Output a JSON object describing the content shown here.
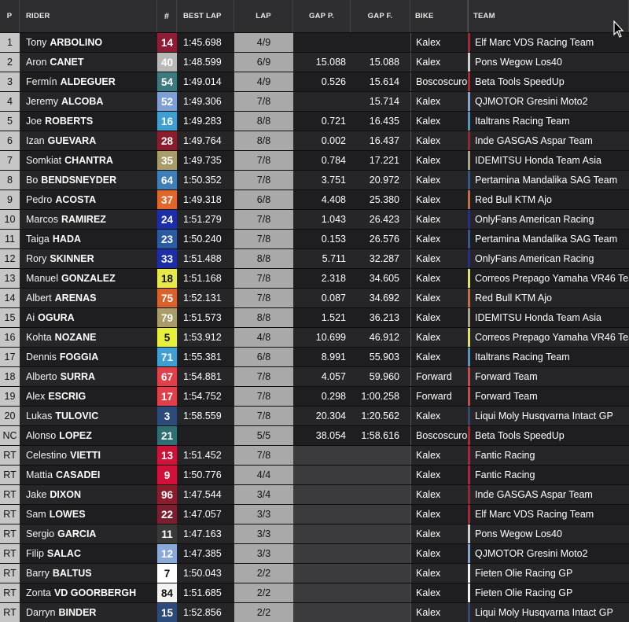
{
  "header": {
    "pos": "P",
    "rider": "RIDER",
    "number": "#",
    "best_lap": "BEST LAP",
    "lap": "LAP",
    "gap_prev": "GAP P.",
    "gap_first": "GAP F.",
    "bike": "BIKE",
    "team": "TEAM"
  },
  "rows": [
    {
      "pos": "1",
      "first": "Tony",
      "last": "ARBOLINO",
      "num": "14",
      "num_color": "#8e1c34",
      "text_dark": false,
      "best": "1:45.698",
      "lap": "4/9",
      "gap_p": "",
      "gap_f": "",
      "bike": "Kalex",
      "team": "Elf Marc VDS Racing Team",
      "team_color": "#c4182b"
    },
    {
      "pos": "2",
      "first": "Aron",
      "last": "CANET",
      "num": "40",
      "num_color": "#b8b8b8",
      "text_dark": false,
      "best": "1:48.599",
      "lap": "6/9",
      "gap_p": "15.088",
      "gap_f": "15.088",
      "bike": "Kalex",
      "team": "Pons Wegow Los40",
      "team_color": "#d0d0d0"
    },
    {
      "pos": "3",
      "first": "Fermín",
      "last": "ALDEGUER",
      "num": "54",
      "num_color": "#3d7a7f",
      "text_dark": false,
      "best": "1:49.014",
      "lap": "4/9",
      "gap_p": "0.526",
      "gap_f": "15.614",
      "bike": "Boscoscuro",
      "team": "Beta Tools SpeedUp",
      "team_color": "#c81d25"
    },
    {
      "pos": "4",
      "first": "Jeremy",
      "last": "ALCOBA",
      "num": "52",
      "num_color": "#7d9fd6",
      "text_dark": false,
      "best": "1:49.306",
      "lap": "7/8",
      "gap_p": "",
      "gap_f": "15.714",
      "bike": "Kalex",
      "team": "QJMOTOR Gresini Moto2",
      "team_color": "#7da7dd"
    },
    {
      "pos": "5",
      "first": "Joe",
      "last": "ROBERTS",
      "num": "16",
      "num_color": "#3e9fd0",
      "text_dark": false,
      "best": "1:49.283",
      "lap": "8/8",
      "gap_p": "0.721",
      "gap_f": "16.435",
      "bike": "Kalex",
      "team": "Italtrans Racing Team",
      "team_color": "#3e9fd0"
    },
    {
      "pos": "6",
      "first": "Izan",
      "last": "GUEVARA",
      "num": "28",
      "num_color": "#8c1c2c",
      "text_dark": false,
      "best": "1:49.764",
      "lap": "8/8",
      "gap_p": "0.002",
      "gap_f": "16.437",
      "bike": "Kalex",
      "team": "Inde GASGAS Aspar Team",
      "team_color": "#b01a2a"
    },
    {
      "pos": "7",
      "first": "Somkiat",
      "last": "CHANTRA",
      "num": "35",
      "num_color": "#a89c6a",
      "text_dark": false,
      "best": "1:49.735",
      "lap": "7/8",
      "gap_p": "0.784",
      "gap_f": "17.221",
      "bike": "Kalex",
      "team": "IDEMITSU Honda Team Asia",
      "team_color": "#b0a578"
    },
    {
      "pos": "8",
      "first": "Bo",
      "last": "BENDSNEYDER",
      "num": "64",
      "num_color": "#3e7fb8",
      "text_dark": false,
      "best": "1:50.352",
      "lap": "7/8",
      "gap_p": "3.751",
      "gap_f": "20.972",
      "bike": "Kalex",
      "team": "Pertamina Mandalika SAG Team",
      "team_color": "#2c5aa0"
    },
    {
      "pos": "9",
      "first": "Pedro",
      "last": "ACOSTA",
      "num": "37",
      "num_color": "#e0662a",
      "text_dark": false,
      "best": "1:49.318",
      "lap": "6/8",
      "gap_p": "4.408",
      "gap_f": "25.380",
      "bike": "Kalex",
      "team": "Red Bull KTM Ajo",
      "team_color": "#e0662a"
    },
    {
      "pos": "10",
      "first": "Marcos",
      "last": "RAMIREZ",
      "num": "24",
      "num_color": "#1b2da8",
      "text_dark": false,
      "best": "1:51.279",
      "lap": "7/8",
      "gap_p": "1.043",
      "gap_f": "26.423",
      "bike": "Kalex",
      "team": "OnlyFans American Racing",
      "team_color": "#1b2da8"
    },
    {
      "pos": "11",
      "first": "Taiga",
      "last": "HADA",
      "num": "23",
      "num_color": "#2c5aa0",
      "text_dark": false,
      "best": "1:50.240",
      "lap": "7/8",
      "gap_p": "0.153",
      "gap_f": "26.576",
      "bike": "Kalex",
      "team": "Pertamina Mandalika SAG Team",
      "team_color": "#2c5aa0"
    },
    {
      "pos": "12",
      "first": "Rory",
      "last": "SKINNER",
      "num": "33",
      "num_color": "#1b2da8",
      "text_dark": false,
      "best": "1:51.488",
      "lap": "8/8",
      "gap_p": "5.711",
      "gap_f": "32.287",
      "bike": "Kalex",
      "team": "OnlyFans American Racing",
      "team_color": "#1b2da8"
    },
    {
      "pos": "13",
      "first": "Manuel",
      "last": "GONZALEZ",
      "num": "18",
      "num_color": "#e6e84a",
      "text_dark": true,
      "best": "1:51.168",
      "lap": "7/8",
      "gap_p": "2.318",
      "gap_f": "34.605",
      "bike": "Kalex",
      "team": "Correos Prepago Yamaha VR46 Tean",
      "team_color": "#e6e84a"
    },
    {
      "pos": "14",
      "first": "Albert",
      "last": "ARENAS",
      "num": "75",
      "num_color": "#d9622a",
      "text_dark": false,
      "best": "1:52.131",
      "lap": "7/8",
      "gap_p": "0.087",
      "gap_f": "34.692",
      "bike": "Kalex",
      "team": "Red Bull KTM Ajo",
      "team_color": "#e0662a"
    },
    {
      "pos": "15",
      "first": "Ai",
      "last": "OGURA",
      "num": "79",
      "num_color": "#a89c6a",
      "text_dark": false,
      "best": "1:51.573",
      "lap": "8/8",
      "gap_p": "1.521",
      "gap_f": "36.213",
      "bike": "Kalex",
      "team": "IDEMITSU Honda Team Asia",
      "team_color": "#b0a578"
    },
    {
      "pos": "16",
      "first": "Kohta",
      "last": "NOZANE",
      "num": "5",
      "num_color": "#e6f03c",
      "text_dark": true,
      "best": "1:53.912",
      "lap": "4/8",
      "gap_p": "10.699",
      "gap_f": "46.912",
      "bike": "Kalex",
      "team": "Correos Prepago Yamaha VR46 Tean",
      "team_color": "#e6e84a"
    },
    {
      "pos": "17",
      "first": "Dennis",
      "last": "FOGGIA",
      "num": "71",
      "num_color": "#3e9fd0",
      "text_dark": false,
      "best": "1:55.381",
      "lap": "6/8",
      "gap_p": "8.991",
      "gap_f": "55.903",
      "bike": "Kalex",
      "team": "Italtrans Racing Team",
      "team_color": "#3e9fd0"
    },
    {
      "pos": "18",
      "first": "Alberto",
      "last": "SURRA",
      "num": "67",
      "num_color": "#e0404a",
      "text_dark": false,
      "best": "1:54.881",
      "lap": "7/8",
      "gap_p": "4.057",
      "gap_f": "59.960",
      "bike": "Forward",
      "team": "Forward Team",
      "team_color": "#e04040"
    },
    {
      "pos": "19",
      "first": "Alex",
      "last": "ESCRIG",
      "num": "17",
      "num_color": "#e0404a",
      "text_dark": false,
      "best": "1:54.752",
      "lap": "7/8",
      "gap_p": "0.298",
      "gap_f": "1:00.258",
      "bike": "Forward",
      "team": "Forward Team",
      "team_color": "#e04040"
    },
    {
      "pos": "20",
      "first": "Lukas",
      "last": "TULOVIC",
      "num": "3",
      "num_color": "#2c4a7a",
      "text_dark": false,
      "best": "1:58.559",
      "lap": "7/8",
      "gap_p": "20.304",
      "gap_f": "1:20.562",
      "bike": "Kalex",
      "team": "Liqui Moly Husqvarna Intact GP",
      "team_color": "#2c4a7a"
    },
    {
      "pos": "NC",
      "first": "Alonso",
      "last": "LOPEZ",
      "num": "21",
      "num_color": "#2e6f73",
      "text_dark": false,
      "best": "",
      "lap": "5/5",
      "gap_p": "38.054",
      "gap_f": "1:58.616",
      "bike": "Boscoscuro",
      "team": "Beta Tools SpeedUp",
      "team_color": "#c81d25"
    },
    {
      "pos": "RT",
      "first": "Celestino",
      "last": "VIETTI",
      "num": "13",
      "num_color": "#d0123a",
      "text_dark": false,
      "best": "1:51.452",
      "lap": "7/8",
      "gap_p": "",
      "gap_f": "",
      "bike": "Kalex",
      "team": "Fantic Racing",
      "team_color": "#d0123a"
    },
    {
      "pos": "RT",
      "first": "Mattia",
      "last": "CASADEI",
      "num": "9",
      "num_color": "#d0123a",
      "text_dark": false,
      "best": "1:50.776",
      "lap": "4/4",
      "gap_p": "",
      "gap_f": "",
      "bike": "Kalex",
      "team": "Fantic Racing",
      "team_color": "#d0123a"
    },
    {
      "pos": "RT",
      "first": "Jake",
      "last": "DIXON",
      "num": "96",
      "num_color": "#8c1c2c",
      "text_dark": false,
      "best": "1:47.544",
      "lap": "3/4",
      "gap_p": "",
      "gap_f": "",
      "bike": "Kalex",
      "team": "Inde GASGAS Aspar Team",
      "team_color": "#b01a2a"
    },
    {
      "pos": "RT",
      "first": "Sam",
      "last": "LOWES",
      "num": "22",
      "num_color": "#7a1e30",
      "text_dark": false,
      "best": "1:47.057",
      "lap": "3/3",
      "gap_p": "",
      "gap_f": "",
      "bike": "Kalex",
      "team": "Elf Marc VDS Racing Team",
      "team_color": "#c4182b"
    },
    {
      "pos": "RT",
      "first": "Sergio",
      "last": "GARCIA",
      "num": "11",
      "num_color": "#3a3a3a",
      "text_dark": false,
      "best": "1:47.163",
      "lap": "3/3",
      "gap_p": "",
      "gap_f": "",
      "bike": "Kalex",
      "team": "Pons Wegow Los40",
      "team_color": "#d0d0d0"
    },
    {
      "pos": "RT",
      "first": "Filip",
      "last": "SALAC",
      "num": "12",
      "num_color": "#8aa8d8",
      "text_dark": false,
      "best": "1:47.385",
      "lap": "3/3",
      "gap_p": "",
      "gap_f": "",
      "bike": "Kalex",
      "team": "QJMOTOR Gresini Moto2",
      "team_color": "#7da7dd"
    },
    {
      "pos": "RT",
      "first": "Barry",
      "last": "BALTUS",
      "num": "7",
      "num_color": "#ffffff",
      "text_dark": true,
      "best": "1:50.043",
      "lap": "2/2",
      "gap_p": "",
      "gap_f": "",
      "bike": "Kalex",
      "team": "Fieten Olie Racing GP",
      "team_color": "#f0f0f0"
    },
    {
      "pos": "RT",
      "first": "Zonta",
      "last": "VD GOORBERGH",
      "num": "84",
      "num_color": "#f2f2f2",
      "text_dark": true,
      "best": "1:51.685",
      "lap": "2/2",
      "gap_p": "",
      "gap_f": "",
      "bike": "Kalex",
      "team": "Fieten Olie Racing GP",
      "team_color": "#f0f0f0"
    },
    {
      "pos": "RT",
      "first": "Darryn",
      "last": "BINDER",
      "num": "15",
      "num_color": "#2c4a7a",
      "text_dark": false,
      "best": "1:52.856",
      "lap": "2/2",
      "gap_p": "",
      "gap_f": "",
      "bike": "Kalex",
      "team": "Liqui Moly Husqvarna Intact GP",
      "team_color": "#2c4a7a"
    }
  ]
}
